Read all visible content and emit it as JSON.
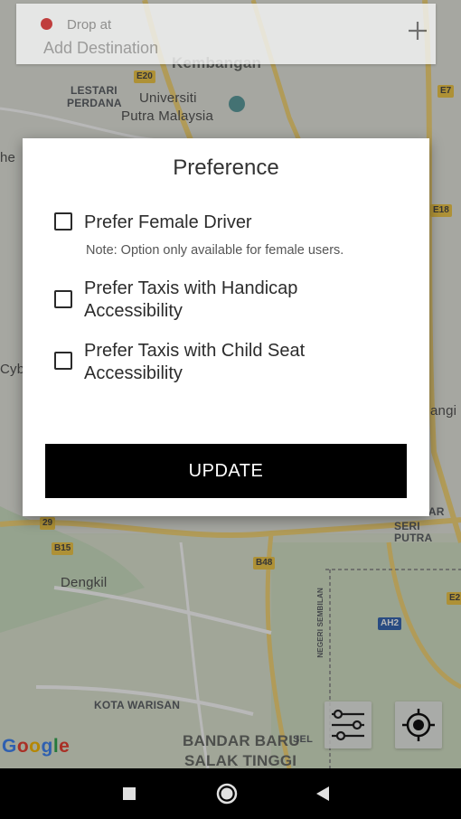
{
  "map": {
    "labels": {
      "kembangan": "Kembangan",
      "lestari": "LESTARI",
      "perdana": "PERDANA",
      "universiti": "Universiti",
      "putra": "Putra Malaysia",
      "cyber_left": "he",
      "cyber2": "Cybe",
      "dengkil": "Dengkil",
      "kota_warisan": "KOTA WARISAN",
      "bandar_baru": "BANDAR BARU",
      "salak_tinggi": "SALAK TINGGI",
      "bandar_seri": "DAR",
      "seri_putra": "SERI PUTRA",
      "bangi": "angi",
      "negeri": "NEGERI SEMBILAN",
      "sel": "SEL"
    },
    "roads": [
      "E20",
      "E7",
      "E18",
      "29",
      "B15",
      "B48",
      "AH2",
      "E2"
    ],
    "google_logo": "Google"
  },
  "destination": {
    "caption": "Drop at",
    "placeholder": "Add Destination",
    "add_icon": "plus-icon"
  },
  "dialog": {
    "title": "Preference",
    "options": [
      {
        "label": "Prefer Female Driver",
        "checked": false
      },
      {
        "label": "Prefer Taxis with Handicap Accessibility",
        "checked": false
      },
      {
        "label": "Prefer Taxis with Child Seat Accessibility",
        "checked": false
      }
    ],
    "note": "Note: Option only available for female users.",
    "update_label": "UPDATE"
  },
  "fabs": {
    "filter_icon": "sliders-icon",
    "locate_icon": "my-location-icon"
  },
  "navbar": {
    "recent_icon": "square-icon",
    "home_icon": "circle-icon",
    "back_icon": "triangle-back-icon"
  },
  "colors": {
    "marker_red": "#c62828",
    "button_black": "#000000",
    "road_yellow": "#f2c94c"
  }
}
